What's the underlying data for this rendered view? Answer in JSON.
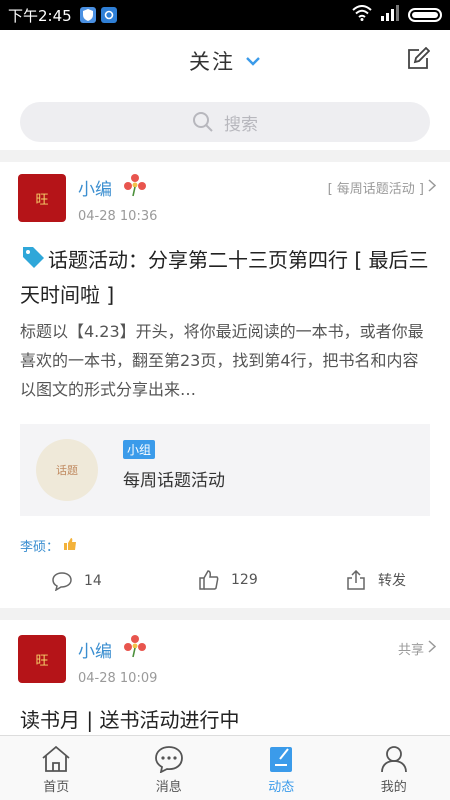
{
  "status_bar": {
    "time": "下午2:45"
  },
  "header": {
    "title": "关注"
  },
  "search": {
    "placeholder": "搜索"
  },
  "posts": [
    {
      "author": "小编",
      "avatar_text": "旺",
      "time": "04-28 10:36",
      "topic_link": "[ 每周话题活动 ]",
      "title": "话题活动：分享第二十三页第四行 [ 最后三天时间啦 ]",
      "body": "标题以【4.23】开头，将你最近阅读的一本书，或者你最喜欢的一本书，翻至第23页，找到第4行，把书名和内容以图文的形式分享出来…",
      "group": {
        "badge": "小组",
        "name": "每周话题活动",
        "thumb_text": "话题"
      },
      "liker": "李硕：",
      "comments": "14",
      "likes": "129",
      "share_label": "转发"
    },
    {
      "author": "小编",
      "avatar_text": "旺",
      "time": "04-28 10:09",
      "topic_link": "共享",
      "title": "读书月 | 送书活动进行中"
    }
  ],
  "tabbar": {
    "items": [
      {
        "label": "首页",
        "icon": "home-icon"
      },
      {
        "label": "消息",
        "icon": "message-icon"
      },
      {
        "label": "动态",
        "icon": "feed-icon",
        "active": true
      },
      {
        "label": "我的",
        "icon": "profile-icon"
      }
    ]
  },
  "colors": {
    "accent": "#3b9bea",
    "username": "#3a8ed0",
    "avatar_bg": "#b51418"
  }
}
